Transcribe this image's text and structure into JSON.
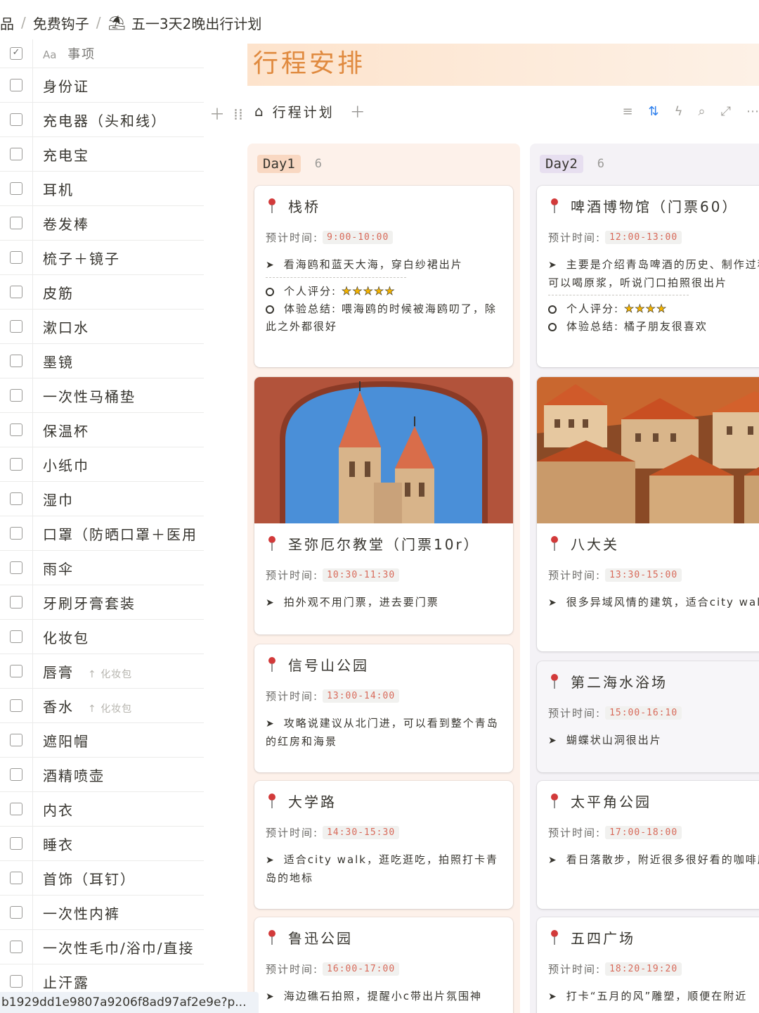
{
  "breadcrumb": {
    "left_fragment": "品",
    "parent": "免费钩子",
    "page_emoji": "⛱",
    "page": "五一3天2晚出行计划"
  },
  "checklist": {
    "header_icon": "Aa",
    "header_label": "事项",
    "items": [
      {
        "label": "身份证"
      },
      {
        "label": "充电器（头和线）"
      },
      {
        "label": "充电宝"
      },
      {
        "label": "耳机"
      },
      {
        "label": "卷发棒"
      },
      {
        "label": "梳子＋镜子"
      },
      {
        "label": "皮筋"
      },
      {
        "label": "漱口水"
      },
      {
        "label": "墨镜"
      },
      {
        "label": "一次性马桶垫"
      },
      {
        "label": "保温杯"
      },
      {
        "label": "小纸巾"
      },
      {
        "label": "湿巾"
      },
      {
        "label": "口罩（防晒口罩＋医用"
      },
      {
        "label": "雨伞"
      },
      {
        "label": "牙刷牙膏套装"
      },
      {
        "label": "化妆包"
      },
      {
        "label": "唇膏",
        "parent": "化妆包"
      },
      {
        "label": "香水",
        "parent": "化妆包"
      },
      {
        "label": "遮阳帽"
      },
      {
        "label": "酒精喷壶"
      },
      {
        "label": "内衣"
      },
      {
        "label": "睡衣"
      },
      {
        "label": "首饰（耳钉）"
      },
      {
        "label": "一次性内裤"
      },
      {
        "label": "一次性毛巾/浴巾/直接"
      },
      {
        "label": "止汗露"
      }
    ]
  },
  "banner": {
    "title": "行程安排"
  },
  "view": {
    "icon": "house-icon",
    "name": "行程计划"
  },
  "board": {
    "time_label": "预计时间:",
    "columns": [
      {
        "tag": "Day1",
        "count": "6",
        "cards": [
          {
            "title": "栈桥",
            "time": "9:00-10:00",
            "desc": "看海鸥和蓝天大海，穿白纱裙出片",
            "rating_label": "个人评分:",
            "stars": "★★★★★",
            "summary_label": "体验总结:",
            "summary": "喂海鸥的时候被海鸥叨了，除此之外都很好"
          },
          {
            "title": "圣弥厄尔教堂（门票10r）",
            "time": "10:30-11:30",
            "desc": "拍外观不用门票，进去要门票"
          },
          {
            "title": "信号山公园",
            "time": "13:00-14:00",
            "desc": "攻略说建议从北门进，可以看到整个青岛的红房和海景"
          },
          {
            "title": "大学路",
            "time": "14:30-15:30",
            "desc": "适合city walk，逛吃逛吃，拍照打卡青岛的地标"
          },
          {
            "title": "鲁迅公园",
            "time": "16:00-17:00",
            "desc": "海边礁石拍照，提醒小c带出片氛围神"
          }
        ]
      },
      {
        "tag": "Day2",
        "count": "6",
        "cards": [
          {
            "title": "啤酒博物馆（门票60）",
            "time": "12:00-13:00",
            "desc": "主要是介绍青岛啤酒的历史、制作过程，可以喝原浆，听说门口拍照很出片",
            "rating_label": "个人评分:",
            "stars": "★★★★",
            "summary_label": "体验总结:",
            "summary": "橘子朋友很喜欢"
          },
          {
            "title": "八大关",
            "time": "13:30-15:00",
            "desc": "很多异域风情的建筑，适合city walk"
          },
          {
            "title": "第二海水浴场",
            "time": "15:00-16:10",
            "desc": "蝴蝶状山洞很出片"
          },
          {
            "title": "太平角公园",
            "time": "17:00-18:00",
            "desc": "看日落散步，附近很多很好看的咖啡厅"
          },
          {
            "title": "五四广场",
            "time": "18:20-19:20",
            "desc": "打卡“五月的风”雕塑，顺便在附近"
          }
        ]
      }
    ]
  },
  "status_url": "b1929dd1e9807a9206f8ad97af2e9e?p..."
}
